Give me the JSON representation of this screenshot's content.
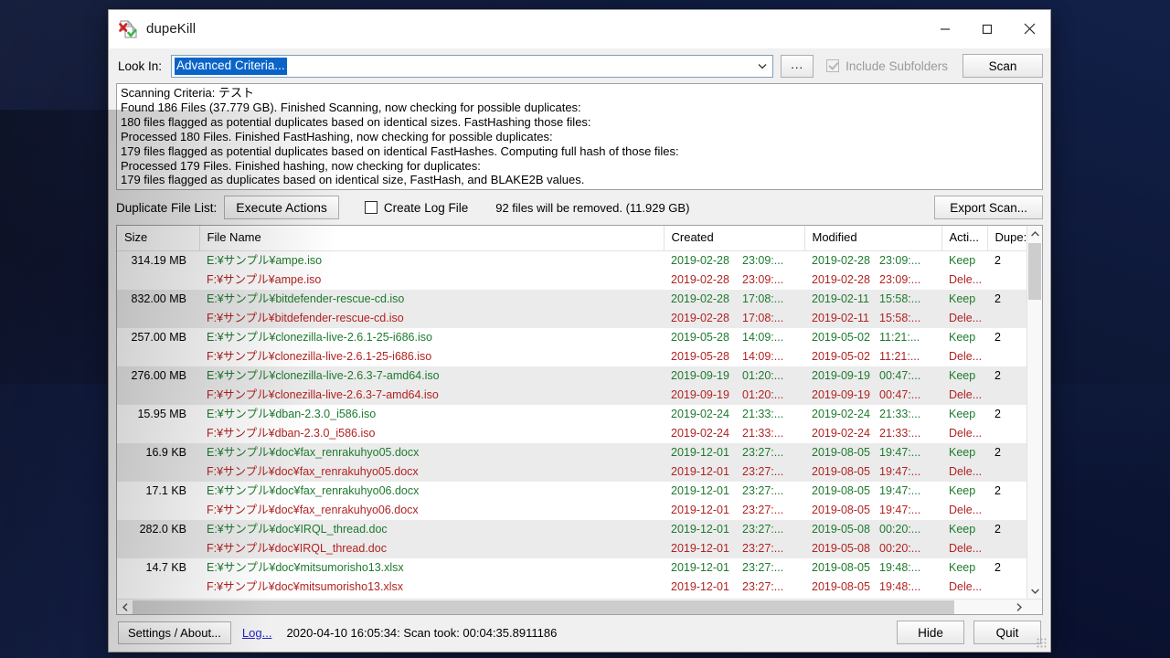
{
  "window": {
    "title": "dupeKill",
    "icon": "dupekill-app-icon",
    "minimize": "—",
    "maximize": "□",
    "close": "✕"
  },
  "lookin": {
    "label": "Look In:",
    "value": "Advanced Criteria...",
    "browse_button": "...",
    "dropdown_icon": "chevron-down-icon",
    "include_subfolders_label": "Include Subfolders",
    "include_subfolders_checked": true,
    "include_subfolders_disabled": true,
    "scan_button": "Scan"
  },
  "log": {
    "lines": [
      "Scanning Criteria: テスト",
      "Found 186 Files (37.779 GB). Finished Scanning, now checking for possible duplicates:",
      "180 files flagged as potential duplicates based on identical sizes. FastHashing those files:",
      "Processed 180 Files. Finished FastHashing, now checking for possible duplicates:",
      "179 files flagged as potential duplicates based on identical FastHashes. Computing full hash of those files:",
      "Processed 179 Files. Finished hashing, now checking for duplicates:",
      "179 files flagged as duplicates based on identical size, FastHash, and BLAKE2B values."
    ]
  },
  "actions": {
    "duplicate_list_label": "Duplicate File List:",
    "execute_button": "Execute Actions",
    "create_log_label": "Create Log File",
    "create_log_checked": true,
    "removed_summary": "92 files will be removed. (11.929 GB)",
    "export_button": "Export Scan..."
  },
  "table": {
    "columns": [
      "Size",
      "File Name",
      "Created",
      "Modified",
      "Acti...",
      "Dupe:"
    ],
    "rows": [
      {
        "group": 0,
        "size": "314.19 MB",
        "name": "E:¥サンプル¥ampe.iso",
        "created_date": "2019-02-28",
        "created_time": "23:09:...",
        "modified_date": "2019-02-28",
        "modified_time": "23:09:...",
        "action": "Keep",
        "dupes": "2",
        "state": "keep"
      },
      {
        "group": 0,
        "size": "",
        "name": "F:¥サンプル¥ampe.iso",
        "created_date": "2019-02-28",
        "created_time": "23:09:...",
        "modified_date": "2019-02-28",
        "modified_time": "23:09:...",
        "action": "Dele...",
        "dupes": "",
        "state": "del"
      },
      {
        "group": 1,
        "size": "832.00 MB",
        "name": "E:¥サンプル¥bitdefender-rescue-cd.iso",
        "created_date": "2019-02-28",
        "created_time": "17:08:...",
        "modified_date": "2019-02-11",
        "modified_time": "15:58:...",
        "action": "Keep",
        "dupes": "2",
        "state": "keep"
      },
      {
        "group": 1,
        "size": "",
        "name": "F:¥サンプル¥bitdefender-rescue-cd.iso",
        "created_date": "2019-02-28",
        "created_time": "17:08:...",
        "modified_date": "2019-02-11",
        "modified_time": "15:58:...",
        "action": "Dele...",
        "dupes": "",
        "state": "del"
      },
      {
        "group": 2,
        "size": "257.00 MB",
        "name": "E:¥サンプル¥clonezilla-live-2.6.1-25-i686.iso",
        "created_date": "2019-05-28",
        "created_time": "14:09:...",
        "modified_date": "2019-05-02",
        "modified_time": "11:21:...",
        "action": "Keep",
        "dupes": "2",
        "state": "keep"
      },
      {
        "group": 2,
        "size": "",
        "name": "F:¥サンプル¥clonezilla-live-2.6.1-25-i686.iso",
        "created_date": "2019-05-28",
        "created_time": "14:09:...",
        "modified_date": "2019-05-02",
        "modified_time": "11:21:...",
        "action": "Dele...",
        "dupes": "",
        "state": "del"
      },
      {
        "group": 3,
        "size": "276.00 MB",
        "name": "E:¥サンプル¥clonezilla-live-2.6.3-7-amd64.iso",
        "created_date": "2019-09-19",
        "created_time": "01:20:...",
        "modified_date": "2019-09-19",
        "modified_time": "00:47:...",
        "action": "Keep",
        "dupes": "2",
        "state": "keep"
      },
      {
        "group": 3,
        "size": "",
        "name": "F:¥サンプル¥clonezilla-live-2.6.3-7-amd64.iso",
        "created_date": "2019-09-19",
        "created_time": "01:20:...",
        "modified_date": "2019-09-19",
        "modified_time": "00:47:...",
        "action": "Dele...",
        "dupes": "",
        "state": "del"
      },
      {
        "group": 4,
        "size": "15.95 MB",
        "name": "E:¥サンプル¥dban-2.3.0_i586.iso",
        "created_date": "2019-02-24",
        "created_time": "21:33:...",
        "modified_date": "2019-02-24",
        "modified_time": "21:33:...",
        "action": "Keep",
        "dupes": "2",
        "state": "keep"
      },
      {
        "group": 4,
        "size": "",
        "name": "F:¥サンプル¥dban-2.3.0_i586.iso",
        "created_date": "2019-02-24",
        "created_time": "21:33:...",
        "modified_date": "2019-02-24",
        "modified_time": "21:33:...",
        "action": "Dele...",
        "dupes": "",
        "state": "del"
      },
      {
        "group": 5,
        "size": "16.9 KB",
        "name": "E:¥サンプル¥doc¥fax_renrakuhyo05.docx",
        "created_date": "2019-12-01",
        "created_time": "23:27:...",
        "modified_date": "2019-08-05",
        "modified_time": "19:47:...",
        "action": "Keep",
        "dupes": "2",
        "state": "keep"
      },
      {
        "group": 5,
        "size": "",
        "name": "F:¥サンプル¥doc¥fax_renrakuhyo05.docx",
        "created_date": "2019-12-01",
        "created_time": "23:27:...",
        "modified_date": "2019-08-05",
        "modified_time": "19:47:...",
        "action": "Dele...",
        "dupes": "",
        "state": "del"
      },
      {
        "group": 6,
        "size": "17.1 KB",
        "name": "E:¥サンプル¥doc¥fax_renrakuhyo06.docx",
        "created_date": "2019-12-01",
        "created_time": "23:27:...",
        "modified_date": "2019-08-05",
        "modified_time": "19:47:...",
        "action": "Keep",
        "dupes": "2",
        "state": "keep"
      },
      {
        "group": 6,
        "size": "",
        "name": "F:¥サンプル¥doc¥fax_renrakuhyo06.docx",
        "created_date": "2019-12-01",
        "created_time": "23:27:...",
        "modified_date": "2019-08-05",
        "modified_time": "19:47:...",
        "action": "Dele...",
        "dupes": "",
        "state": "del"
      },
      {
        "group": 7,
        "size": "282.0 KB",
        "name": "E:¥サンプル¥doc¥IRQL_thread.doc",
        "created_date": "2019-12-01",
        "created_time": "23:27:...",
        "modified_date": "2019-05-08",
        "modified_time": "00:20:...",
        "action": "Keep",
        "dupes": "2",
        "state": "keep"
      },
      {
        "group": 7,
        "size": "",
        "name": "F:¥サンプル¥doc¥IRQL_thread.doc",
        "created_date": "2019-12-01",
        "created_time": "23:27:...",
        "modified_date": "2019-05-08",
        "modified_time": "00:20:...",
        "action": "Dele...",
        "dupes": "",
        "state": "del"
      },
      {
        "group": 8,
        "size": "14.7 KB",
        "name": "E:¥サンプル¥doc¥mitsumorisho13.xlsx",
        "created_date": "2019-12-01",
        "created_time": "23:27:...",
        "modified_date": "2019-08-05",
        "modified_time": "19:48:...",
        "action": "Keep",
        "dupes": "2",
        "state": "keep"
      },
      {
        "group": 8,
        "size": "",
        "name": "F:¥サンプル¥doc¥mitsumorisho13.xlsx",
        "created_date": "2019-12-01",
        "created_time": "23:27:...",
        "modified_date": "2019-08-05",
        "modified_time": "19:48:...",
        "action": "Dele...",
        "dupes": "",
        "state": "del"
      }
    ]
  },
  "statusbar": {
    "settings_button": "Settings / About...",
    "log_link": "Log...",
    "status_text": "2020-04-10 16:05:34: Scan took: 00:04:35.8911186",
    "hide_button": "Hide",
    "quit_button": "Quit"
  },
  "colors": {
    "keep_green": "#1d7a2e",
    "delete_red": "#b32222",
    "selection_blue": "#0a64c8",
    "link_blue": "#2323c8",
    "desktop": "#0d1736"
  }
}
